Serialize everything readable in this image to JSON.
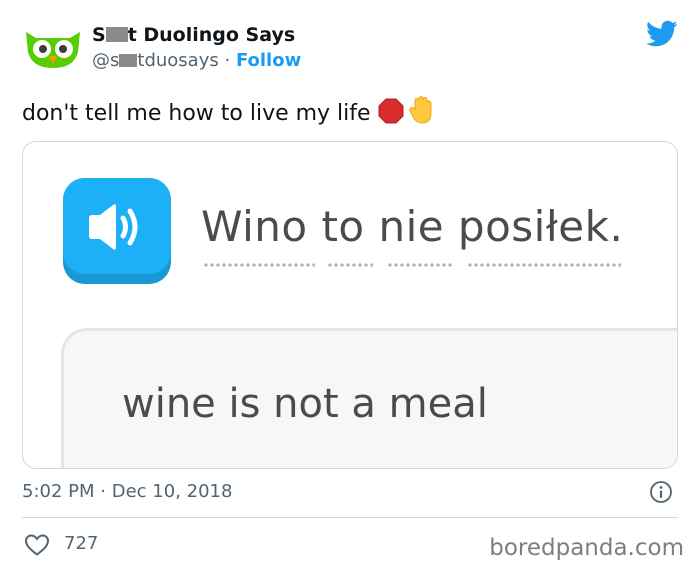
{
  "author": {
    "name_prefix": "S",
    "name_suffix": "t Duolingo Says",
    "handle_prefix": "@s",
    "handle_suffix": "tduosays",
    "separator": "·",
    "follow_label": "Follow"
  },
  "tweet": {
    "text": "don't tell me how to live my life",
    "emojis": [
      "stop-sign",
      "raised-hand"
    ]
  },
  "media": {
    "prompt": "Wino to nie posiłek.",
    "answer": "wine is not a meal"
  },
  "footer": {
    "time": "5:02 PM",
    "separator": "·",
    "date": "Dec 10, 2018",
    "likes": "727"
  },
  "watermark": "boredpanda.com",
  "colors": {
    "twitter_blue": "#1d9bf0",
    "duolingo_blue": "#1cb0f6",
    "owl_green": "#58cc02",
    "text_secondary": "#536471"
  }
}
